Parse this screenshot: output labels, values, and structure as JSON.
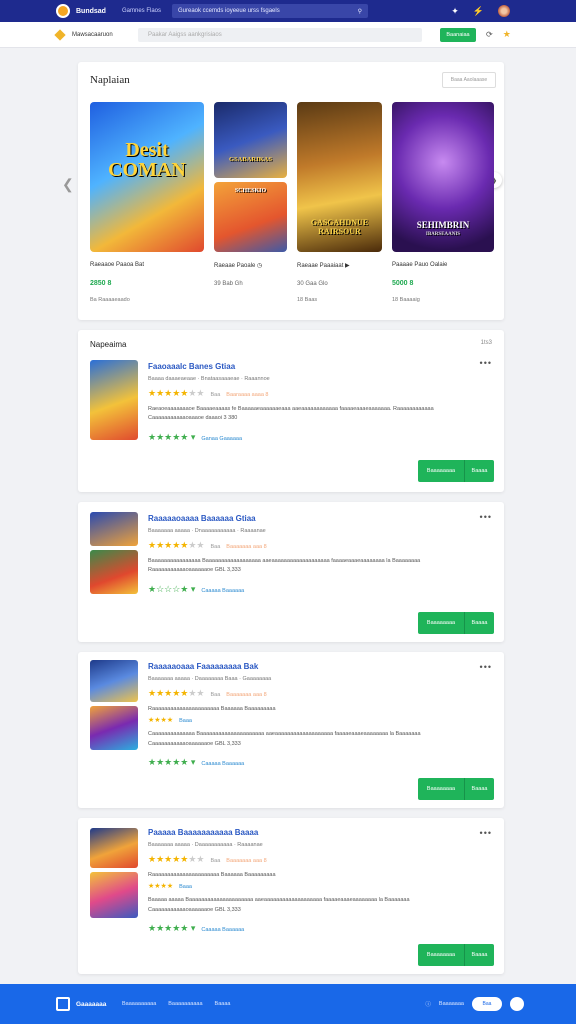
{
  "topbar": {
    "brand": "Bundsad",
    "nav_link": "Gamnes Flaos",
    "search_placeholder": "Gureaok ccemds ioyeeue urss fsgaels",
    "icons": [
      "puzzle-icon",
      "bolt-icon",
      "avatar"
    ]
  },
  "subbar": {
    "title": "Mawsacaaruon",
    "filter_placeholder": "Paakar Aaigss aankgrisiaos",
    "button_label": "Baanaiaa",
    "icons": [
      "refresh-icon",
      "star-icon"
    ]
  },
  "featured": {
    "title": "Naplaian",
    "more_label": "Baaa Aaolaaase",
    "cards": [
      {
        "art_text": "Desit COMAN",
        "name": "Raeaaoe Paaoa Bat",
        "price": "2850 8",
        "meta": "Ba Raaaaeaado",
        "colors": [
          "#2b6fe0",
          "#f3c23a"
        ]
      },
      {
        "art_text": "GSABARIKAS",
        "art_text2": "SCHESKIO",
        "name": "Raeaae Paoale",
        "price": "39 Bab Gh",
        "meta": "",
        "colors": [
          "#274a9a",
          "#e5773a"
        ]
      },
      {
        "art_text": "GASGAHDNUE RAIRSOUR",
        "name": "Raeaae Paaaiaat",
        "price": "30 Gaa Glo",
        "meta": "18 Baas",
        "colors": [
          "#7a4a1c",
          "#e8b449"
        ]
      },
      {
        "art_text": "SEHIMBRIN",
        "art_sub": "IBARSEAANIS",
        "name": "Paaaae Pauo Oalaie",
        "price": "5000 8",
        "meta": "18 Baaaaig",
        "colors": [
          "#5a2a90",
          "#c04ad6"
        ]
      }
    ]
  },
  "reviews_header": {
    "title": "Napeaima",
    "count": "1ts3"
  },
  "reviews": [
    {
      "title": "Faaoaaalc Banes Gtiaa",
      "sub": "Baaaa daaaeaeaae · Bnataasaaaeae · Raaannoe",
      "tag": "Baa",
      "tag2": "Baaraaaa aaaa 8",
      "text": "Raeaoeaaaaaaaoe Baaaaeaaaas fe Baaaaaeaaaaaaeaaa aaeaaaaaaaaaaaa faaaaeaaaeaaaaaaa. Raaaaaaaaaaaa",
      "text2": "Caaaaaaaaaaaoaaaoe daaaoi 3 380",
      "foot_link": "Ganaa Gaaaaaa",
      "btn_a": "Baaaaaaaa",
      "btn_b": "Baaaa"
    },
    {
      "title": "Raaaaaoaaaa Baaaaaa Gtiaa",
      "sub": "Baaaaaaa aaaaa · Dnaaaaaaaaaaa · Raaaanae",
      "tag": "Baa",
      "tag2": "Baaaaaaa aaa 8",
      "text": "Baaaaaaaaaaaaaaaa Baaaaaaaaaaaaaaaaaa aaeaaaaaaaaaaaaaaaaaaa faaaaeaaaeaaaaaaaa la Baaaaaaaa",
      "text2": "Raaaaaaaaaaaoaaaaaaoe GBL 3,333",
      "foot_link": "Caaaaa Baaaaaa",
      "btn_a": "Baaaaaaaa",
      "btn_b": "Baaaa"
    },
    {
      "title": "Raaaaaoaaa Faaaaaaaaa Bak",
      "sub": "Baaaaaaa aaaaa · Daaaaaaaa Baaa · Gaaaaaaaa",
      "tag": "Baa",
      "tag2": "Baaaaaaa aaa 8",
      "line2": "Raaaaaaaaaaaaaaaaaaaaaa Baaaaaa Baaaaaaaaa",
      "line3": "Baaa",
      "text": "Caaaaaaaaaaaaaa Baaaaaaaaaaaaaaaaaaaaa aaeaaaaaaaaaaaaaaaaaaa faaaaeaaaeaaaaaaaa la Baaaaaaa",
      "text2": "Caaaaaaaaaaaoaaaaaaoe GBL 3,333",
      "foot_link": "Caaaaa Baaaaaa",
      "btn_a": "Baaaaaaaa",
      "btn_b": "Baaaa"
    },
    {
      "title": "Paaaaa Baaaaaaaaaaa Baaaa",
      "sub": "Baaaaaaa aaaaa · Daaaaaaaaaaa · Raaaanae",
      "tag": "Baa",
      "tag2": "Baaaaaaa aaa 8",
      "line2": "Raaaaaaaaaaaaaaaaaaaaaa Baaaaaa Baaaaaaaaa",
      "line3": "Baaa",
      "text": "Baaaaa aaaaa Baaaaaaaaaaaaaaaaaaaaa aaeaaaaaaaaaaaaaaaaaaa faaaaeaaaeaaaaaaaa la Baaaaaaa",
      "text2": "Caaaaaaaaaaaoaaaaaaoe GBL 3,333",
      "foot_link": "Caaaaa Baaaaaa",
      "btn_a": "Baaaaaaaa",
      "btn_b": "Baaaa"
    }
  ],
  "footer": {
    "brand": "Gaaaaaaa",
    "links": [
      "Baaaaaaaaaa",
      "Baaaaaaaaaa",
      "Baaaa"
    ],
    "right_label": "Baaaaaaa",
    "toggle_label": "Baa"
  }
}
